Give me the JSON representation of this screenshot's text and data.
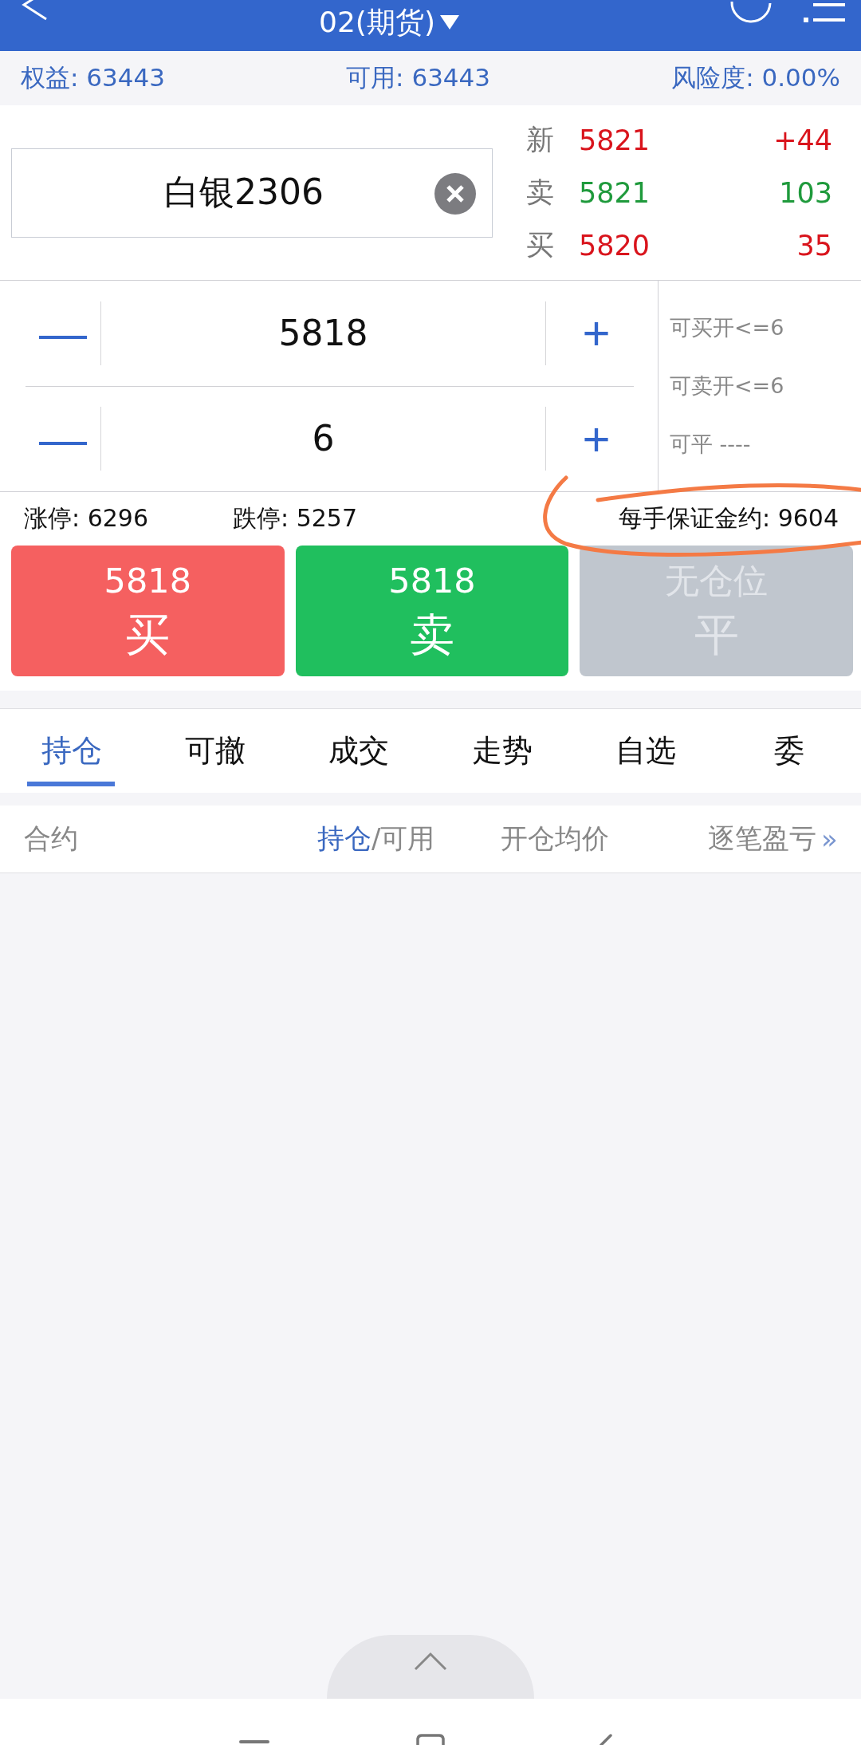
{
  "header": {
    "title": "02(期货)"
  },
  "account": [
    {
      "label": "权益:",
      "value": "63443"
    },
    {
      "label": "可用:",
      "value": "63443"
    },
    {
      "label": "风险度:",
      "value": "0.00%"
    }
  ],
  "contract_field": {
    "value": "白银2306"
  },
  "quotes": [
    {
      "label": "新",
      "price": "5821",
      "change": "+44",
      "color": "#d9141c"
    },
    {
      "label": "卖",
      "price": "5821",
      "change": "103",
      "color": "#1f9a3c"
    },
    {
      "label": "买",
      "price": "5820",
      "change": "35",
      "color": "#d9141c"
    }
  ],
  "steppers": [
    {
      "minus": "—",
      "value": "5818",
      "plus": "+"
    },
    {
      "minus": "—",
      "value": "6",
      "plus": "+"
    }
  ],
  "limits_side": [
    "可买开<=6",
    "可卖开<=6",
    "可平 ----"
  ],
  "limits": {
    "up": "涨停: 6296",
    "down": "跌停: 5257",
    "margin": "每手保证金约: 9604"
  },
  "actions": [
    {
      "kind": "buy",
      "price": "5818",
      "label": "买",
      "disabled": false
    },
    {
      "kind": "sell",
      "price": "5818",
      "label": "卖",
      "disabled": false
    },
    {
      "kind": "close",
      "price": "无仓位",
      "label": "平",
      "disabled": true
    }
  ],
  "tabs": [
    {
      "label": "持仓",
      "selected": true
    },
    {
      "label": "可撤",
      "selected": false
    },
    {
      "label": "成交",
      "selected": false
    },
    {
      "label": "走势",
      "selected": false
    },
    {
      "label": "自选",
      "selected": false
    },
    {
      "label": "委",
      "selected": false
    }
  ],
  "columns": [
    {
      "label": "合约"
    },
    {
      "highlight": "持仓",
      "label": "/可用"
    },
    {
      "label": "开仓均价"
    },
    {
      "label": "逐笔盈亏",
      "more": "»"
    }
  ]
}
